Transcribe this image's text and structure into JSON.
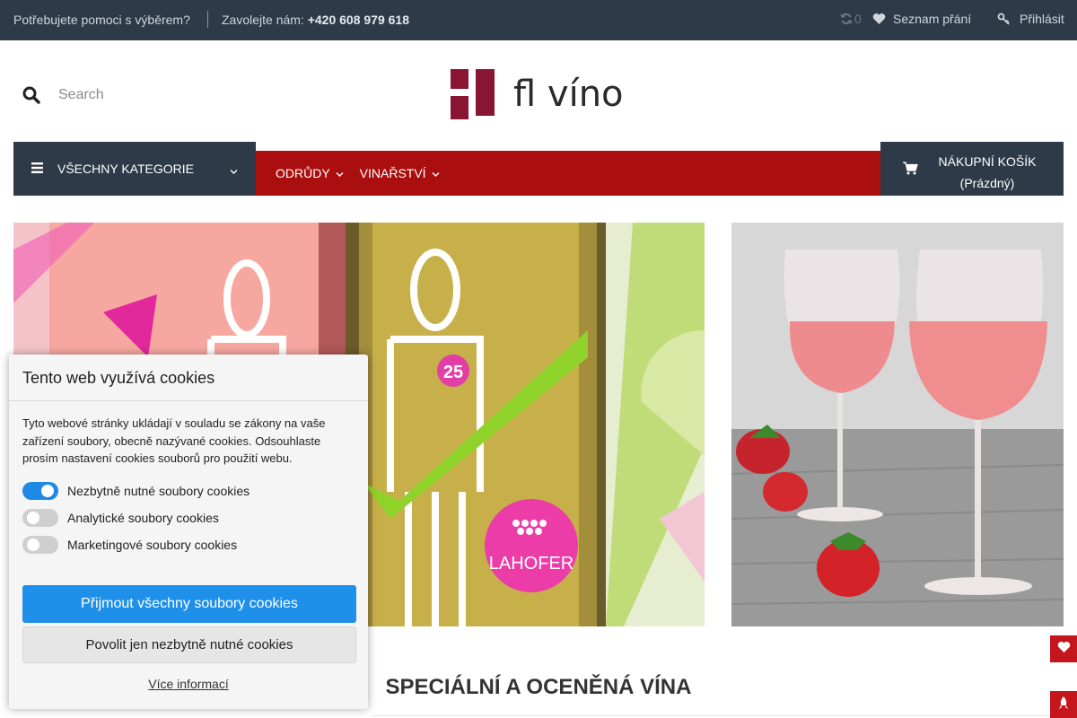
{
  "topbar": {
    "help_text": "Potřebujete pomoci s výběrem?",
    "call_label": "Zavolejte nám:",
    "phone": "+420 608 979 618",
    "compare_count": "0",
    "wishlist_label": "Seznam přání",
    "login_label": "Přihlásit"
  },
  "header": {
    "search_placeholder": "Search",
    "logo_text": "fl víno"
  },
  "nav": {
    "all_categories": "VŠECHNY KATEGORIE",
    "items": [
      {
        "label": "ODRŮDY"
      },
      {
        "label": "VINAŘSTVÍ"
      }
    ],
    "cart_title": "NÁKUPNÍ KOŠÍK",
    "cart_status": "(Prázdný)"
  },
  "banner": {
    "badge_number": "25",
    "winery_label": "LAHOFER"
  },
  "main": {
    "section_title": "SPECIÁLNÍ A OCENĚNÁ VÍNA"
  },
  "cookies": {
    "title": "Tento web využívá cookies",
    "text": "Tyto webové stránky ukládají v souladu se zákony na vaše zařízení soubory, obecně nazývané cookies. Odsouhlaste prosím nastavení cookies souborů pro použití webu.",
    "toggles": [
      {
        "label": "Nezbytně nutné soubory cookies",
        "on": true
      },
      {
        "label": "Analytické soubory cookies",
        "on": false
      },
      {
        "label": "Marketingové soubory cookies",
        "on": false
      }
    ],
    "accept_all": "Přijmout všechny soubory cookies",
    "necessary_only": "Povolit jen nezbytně nutné cookies",
    "more_info": "Více informací"
  },
  "colors": {
    "topbar_bg": "#2e3a48",
    "nav_red": "#aa0e0e",
    "accent_blue": "#1e90ea",
    "logo_wine": "#8a1532"
  }
}
